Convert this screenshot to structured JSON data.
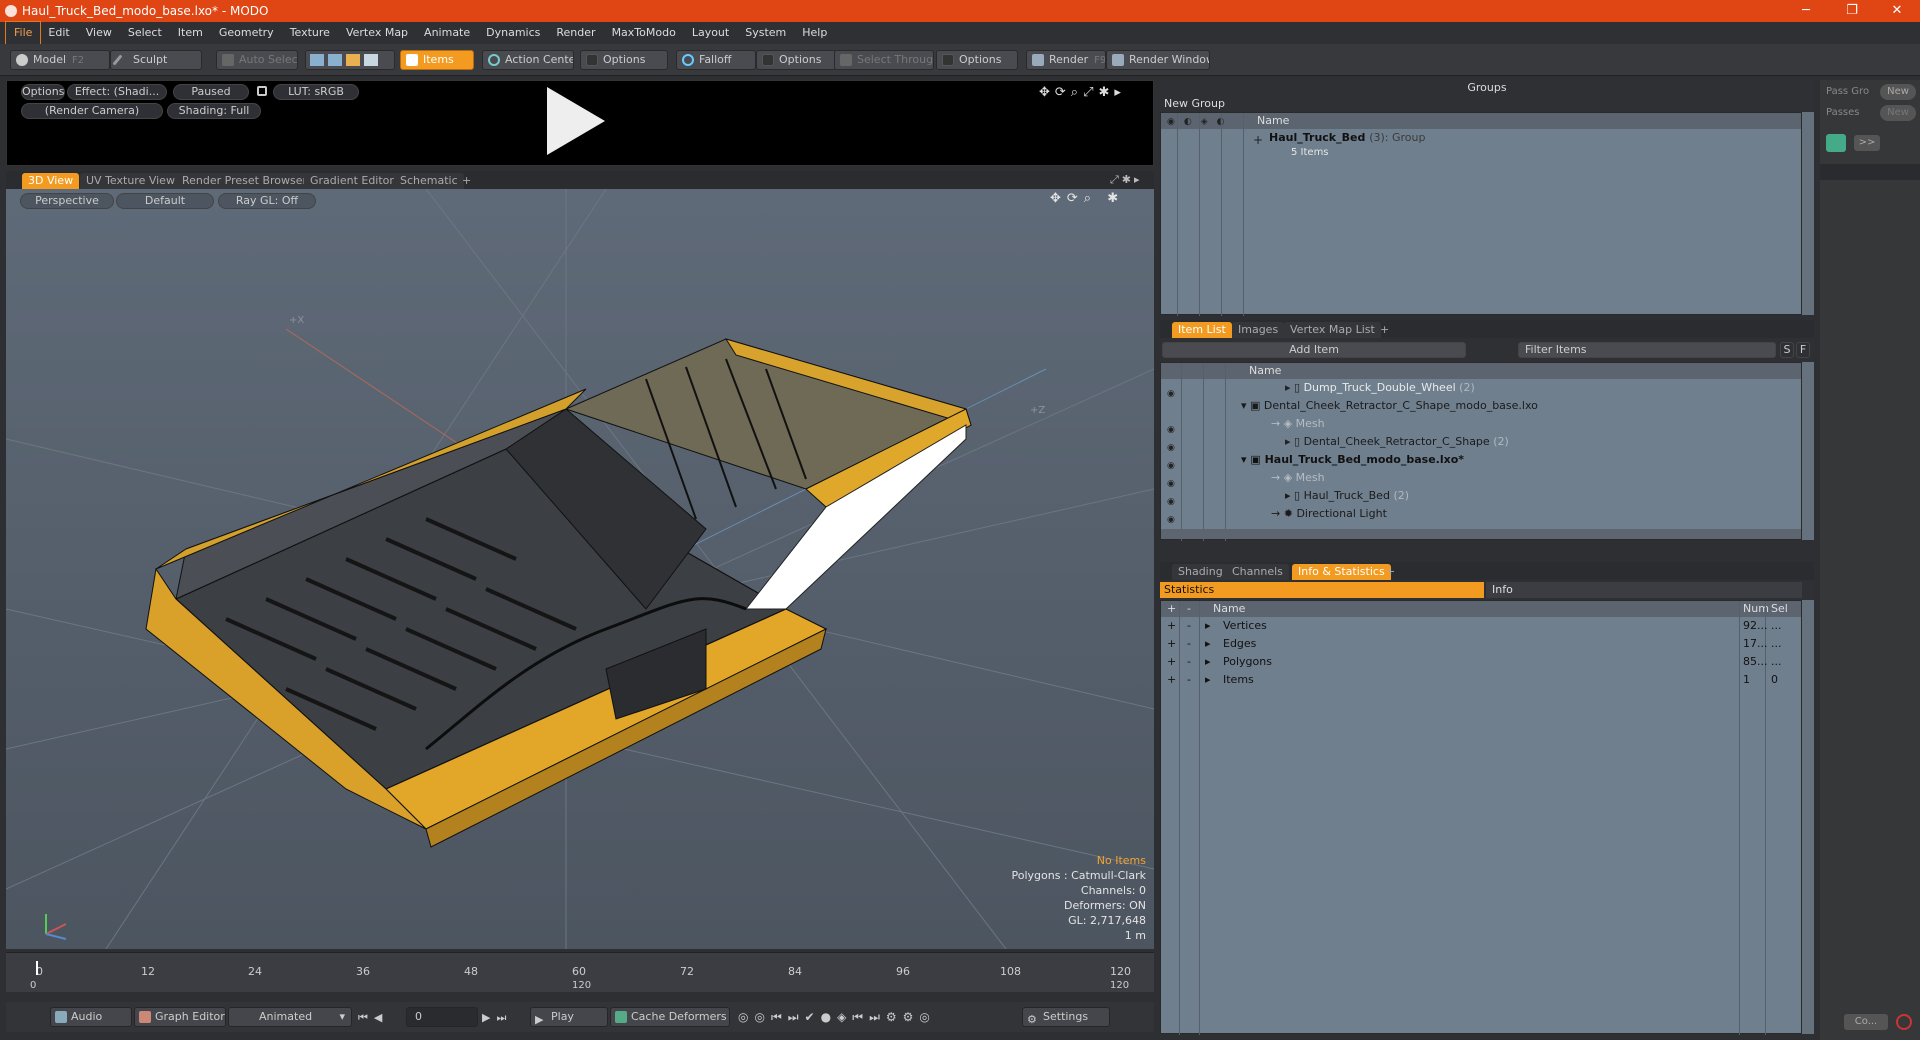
{
  "window": {
    "title": "Haul_Truck_Bed_modo_base.lxo* - MODO",
    "min": "─",
    "max": "❐",
    "close": "✕"
  },
  "menu": [
    "File",
    "Edit",
    "View",
    "Select",
    "Item",
    "Geometry",
    "Texture",
    "Vertex Map",
    "Animate",
    "Dynamics",
    "Render",
    "MaxToModo",
    "Layout",
    "System",
    "Help"
  ],
  "toolbar": {
    "model": "Model",
    "model_key": "F2",
    "sculpt": "Sculpt",
    "auto_select": "Auto Select",
    "items": "Items",
    "action_center": "Action Center",
    "options1": "Options",
    "falloff": "Falloff",
    "options2": "Options",
    "select_through": "Select Through",
    "options3": "Options",
    "render": "Render",
    "render_key": "F9",
    "render_window": "Render Window"
  },
  "preview": {
    "options": "Options",
    "effect": "Effect: (Shadi...",
    "paused": "Paused",
    "lut": "LUT: sRGB",
    "camera": "(Render Camera)",
    "shading": "Shading: Full"
  },
  "view_tabs": [
    "3D View",
    "UV Texture View",
    "Render Preset Browser",
    "Gradient Editor",
    "Schematic",
    "+"
  ],
  "viewport": {
    "perspective": "Perspective",
    "default": "Default",
    "raygl": "Ray GL: Off",
    "axis_x": "+X",
    "axis_z": "+Z",
    "stats": {
      "no_items": "No Items",
      "polygons": "Polygons : Catmull-Clark",
      "channels": "Channels: 0",
      "deformers": "Deformers: ON",
      "gl": "GL: 2,717,648",
      "scale": "1 m"
    }
  },
  "timeline": {
    "ticks": [
      "0",
      "12",
      "24",
      "36",
      "48",
      "60",
      "72",
      "84",
      "96",
      "108",
      "120"
    ],
    "sub_left": "0",
    "sub_mid": "120",
    "sub_right": "120"
  },
  "bottombar": {
    "audio": "Audio",
    "graph_editor": "Graph Editor",
    "animated": "Animated",
    "frame": "0",
    "play": "Play",
    "cache": "Cache Deformers",
    "settings": "Settings"
  },
  "groups": {
    "title": "Groups",
    "new_group": "New Group",
    "name_col": "Name",
    "group_name": "Haul_Truck_Bed",
    "group_count": "(3)",
    "group_type": ": Group",
    "group_items": "5 Items"
  },
  "right_strip": {
    "pass_group": "Pass Gro",
    "new1": "New",
    "passes": "Passes",
    "new2": "New",
    "more": ">>",
    "co": "Co..."
  },
  "item_list": {
    "tabs": [
      "Item List",
      "Images",
      "Vertex Map List",
      "+"
    ],
    "add_item": "Add Item",
    "filter": "Filter Items",
    "s": "S",
    "f": "F",
    "name_col": "Name",
    "rows": [
      {
        "label": "Dump_Truck_Double_Wheel",
        "count": "(2)"
      },
      {
        "label": "Dental_Cheek_Retractor_C_Shape_modo_base.lxo",
        "count": ""
      },
      {
        "label": "Mesh",
        "count": ""
      },
      {
        "label": "Dental_Cheek_Retractor_C_Shape",
        "count": "(2)"
      },
      {
        "label": "Haul_Truck_Bed_modo_base.lxo*",
        "count": ""
      },
      {
        "label": "Mesh",
        "count": ""
      },
      {
        "label": "Haul_Truck_Bed",
        "count": "(2)"
      },
      {
        "label": "Directional Light",
        "count": ""
      }
    ]
  },
  "info": {
    "tabs": [
      "Shading",
      "Channels",
      "Info & Statistics",
      "+"
    ],
    "statistics": "Statistics",
    "info": "Info",
    "name_col": "Name",
    "num_col": "Num",
    "sel_col": "Sel",
    "rows": [
      {
        "name": "Vertices",
        "num": "92...",
        "sel": "..."
      },
      {
        "name": "Edges",
        "num": "17...",
        "sel": "..."
      },
      {
        "name": "Polygons",
        "num": "85...",
        "sel": "..."
      },
      {
        "name": "Items",
        "num": "1",
        "sel": "0"
      }
    ]
  },
  "colors": {
    "accent": "#f29b20",
    "title": "#e04514",
    "panel": "#707f8e"
  }
}
